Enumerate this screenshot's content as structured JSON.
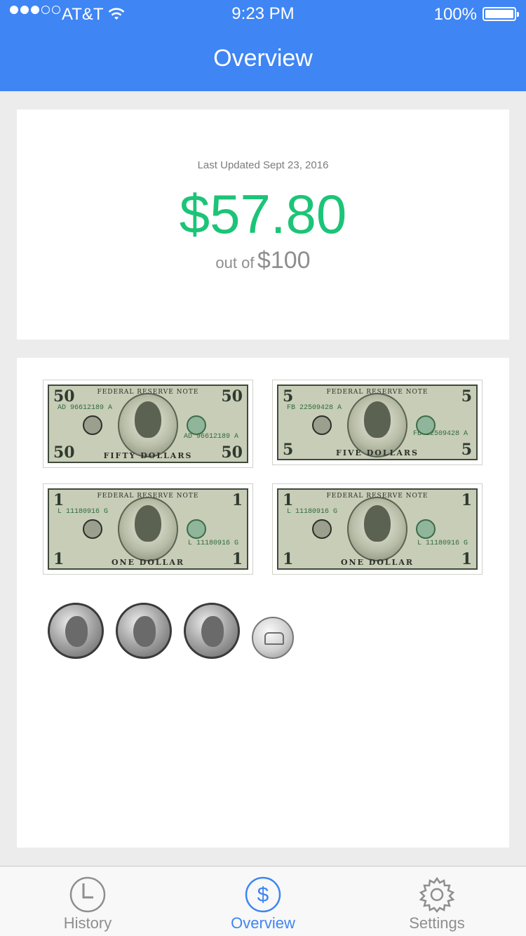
{
  "status_bar": {
    "carrier": "AT&T",
    "time": "9:23 PM",
    "battery": "100%"
  },
  "header": {
    "title": "Overview"
  },
  "summary": {
    "last_updated": "Last Updated Sept 23, 2016",
    "balance": "$57.80",
    "limit_prefix": "out of",
    "limit_value": "$100"
  },
  "money": {
    "bills": [
      {
        "denomination": "50",
        "word": "FIFTY DOLLARS",
        "serial": "AD 96612189 A"
      },
      {
        "denomination": "5",
        "word": "FIVE DOLLARS",
        "serial": "FB 22509428 A"
      },
      {
        "denomination": "1",
        "word": "ONE DOLLAR",
        "serial": "L 11180916 G"
      },
      {
        "denomination": "1",
        "word": "ONE DOLLAR",
        "serial": "L 11180916 G"
      }
    ],
    "coins": [
      "quarter",
      "quarter",
      "quarter",
      "nickel"
    ]
  },
  "tabs": [
    {
      "label": "History",
      "icon": "clock-icon",
      "active": false
    },
    {
      "label": "Overview",
      "icon": "dollar-icon",
      "active": true
    },
    {
      "label": "Settings",
      "icon": "gear-icon",
      "active": false
    }
  ],
  "colors": {
    "brand": "#3f85f4",
    "balance": "#1cc477",
    "inactive_tab": "#8e8e8e"
  }
}
